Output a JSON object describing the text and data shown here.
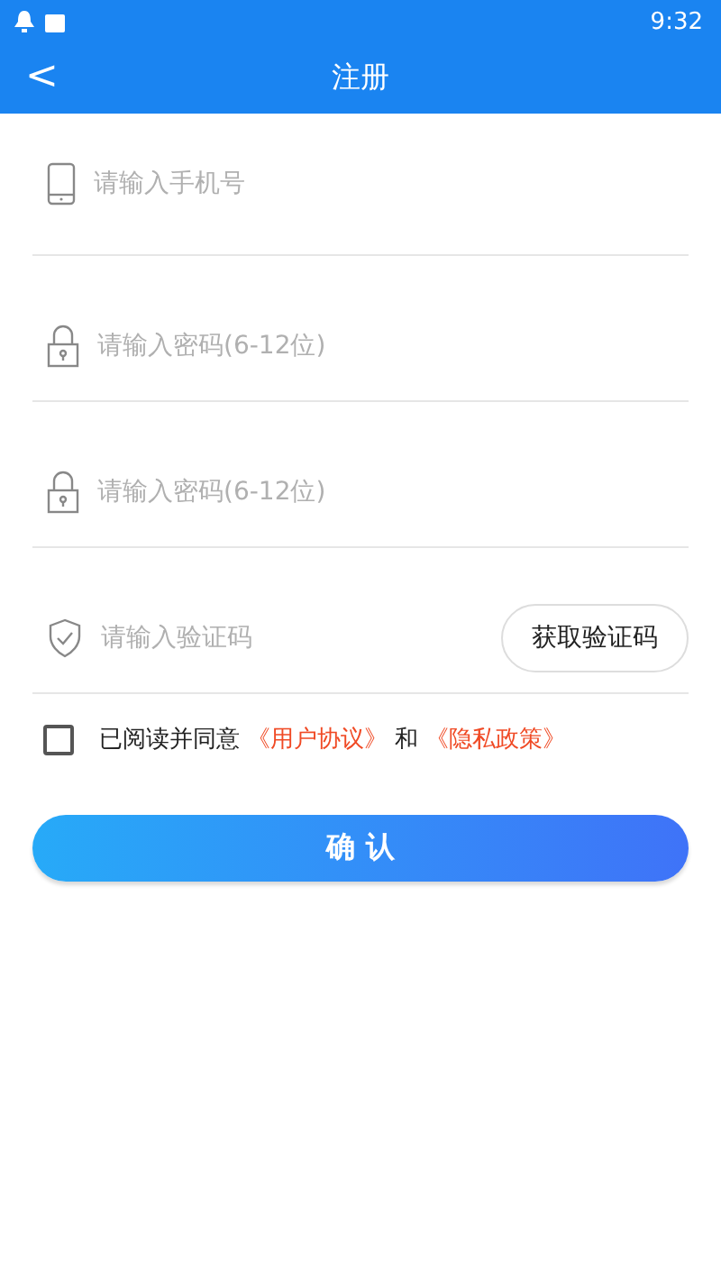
{
  "status_bar": {
    "time": "9:32"
  },
  "header": {
    "back": "<",
    "title": "注册"
  },
  "fields": [
    {
      "kind": "phone",
      "placeholder": "请输入手机号"
    },
    {
      "kind": "lock",
      "placeholder": "请输入密码(6-12位)"
    },
    {
      "kind": "lock",
      "placeholder": "请输入密码(6-12位)"
    },
    {
      "kind": "code",
      "placeholder": "请输入验证码",
      "button": "获取验证码"
    }
  ],
  "agreement": {
    "checked": false,
    "prefix": "已阅读并同意",
    "link_1": "《用户协议》",
    "joiner": "和",
    "link_2": "《隐私政策》"
  },
  "confirm_button": "确 认"
}
